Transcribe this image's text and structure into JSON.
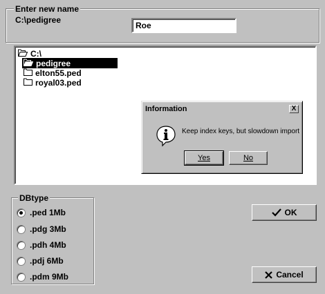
{
  "name_group": {
    "legend": "Enter new name",
    "path": "C:\\pedigree",
    "name_value": "Roe"
  },
  "tree": {
    "items": [
      {
        "label": "C:\\",
        "icon": "open-folder-icon"
      },
      {
        "label": "pedigree",
        "icon": "open-folder-icon"
      },
      {
        "label": "elton55.ped",
        "icon": "folder-icon"
      },
      {
        "label": "royal03.ped",
        "icon": "folder-icon"
      }
    ],
    "selected": "pedigree"
  },
  "dialog": {
    "title": "Information",
    "close_symbol": "X",
    "message": "Keep index keys, but slowdown import",
    "icon": "info-icon",
    "yes_label": "Yes",
    "no_label": "No"
  },
  "dbtype": {
    "legend": "DBtype",
    "options": [
      ".ped 1Mb",
      ".pdg 3Mb",
      ".pdh 4Mb",
      ".pdj 6Mb",
      ".pdm 9Mb"
    ],
    "selected": ".ped 1Mb"
  },
  "buttons": {
    "ok_label": "OK",
    "ok_icon": "checkmark-icon",
    "cancel_label": "Cancel",
    "cancel_icon": "cross-icon"
  }
}
